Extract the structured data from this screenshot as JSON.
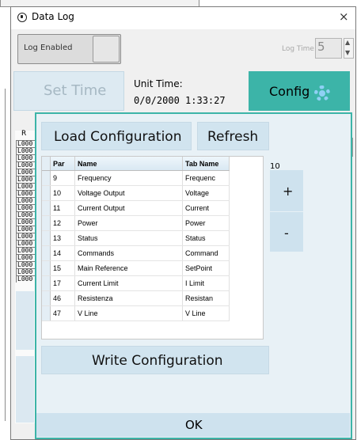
{
  "window": {
    "title": "Data Log",
    "close_glyph": "×"
  },
  "log": {
    "enabled_label": "Log Enabled",
    "time_label": "Log Time",
    "time_value": "5"
  },
  "time": {
    "set_label": "Set Time",
    "unit_label": "Unit Time:",
    "unit_value": "0/0/2000 1:33:27"
  },
  "config": {
    "label": "Config",
    "icon": "gear-icon",
    "accent": "#3cb4a8",
    "gear_color": "#8fd0f4"
  },
  "left_list": {
    "header": "R",
    "rows": [
      "L000",
      "L000",
      "L000",
      "L000",
      "L000",
      "L000",
      "L000",
      "L000",
      "L000",
      "L000",
      "L000",
      "L000",
      "L000",
      "L000",
      "L000",
      "L000",
      "L000",
      "L000",
      "L000",
      "L000"
    ]
  },
  "actions": {
    "load": "Load Configuration",
    "refresh": "Refresh",
    "write": "Write Configuration",
    "ok": "OK"
  },
  "stepper": {
    "value": "10",
    "plus": "+",
    "minus": "-"
  },
  "params": {
    "headers": {
      "par": "Par",
      "name": "Name",
      "tab": "Tab Name"
    },
    "rows": [
      {
        "par": "9",
        "name": "Frequency",
        "tab": "Frequenc"
      },
      {
        "par": "10",
        "name": "Voltage Output",
        "tab": "Voltage"
      },
      {
        "par": "11",
        "name": "Current Output",
        "tab": "Current"
      },
      {
        "par": "12",
        "name": "Power",
        "tab": "Power"
      },
      {
        "par": "13",
        "name": "Status",
        "tab": "Status"
      },
      {
        "par": "14",
        "name": "Commands",
        "tab": "Command"
      },
      {
        "par": "15",
        "name": "Main Reference",
        "tab": "SetPoint"
      },
      {
        "par": "17",
        "name": "Current Limit",
        "tab": "I Limit"
      },
      {
        "par": "46",
        "name": "Resistenza",
        "tab": "Resistan"
      },
      {
        "par": "47",
        "name": "V Line",
        "tab": "V Line"
      }
    ]
  }
}
